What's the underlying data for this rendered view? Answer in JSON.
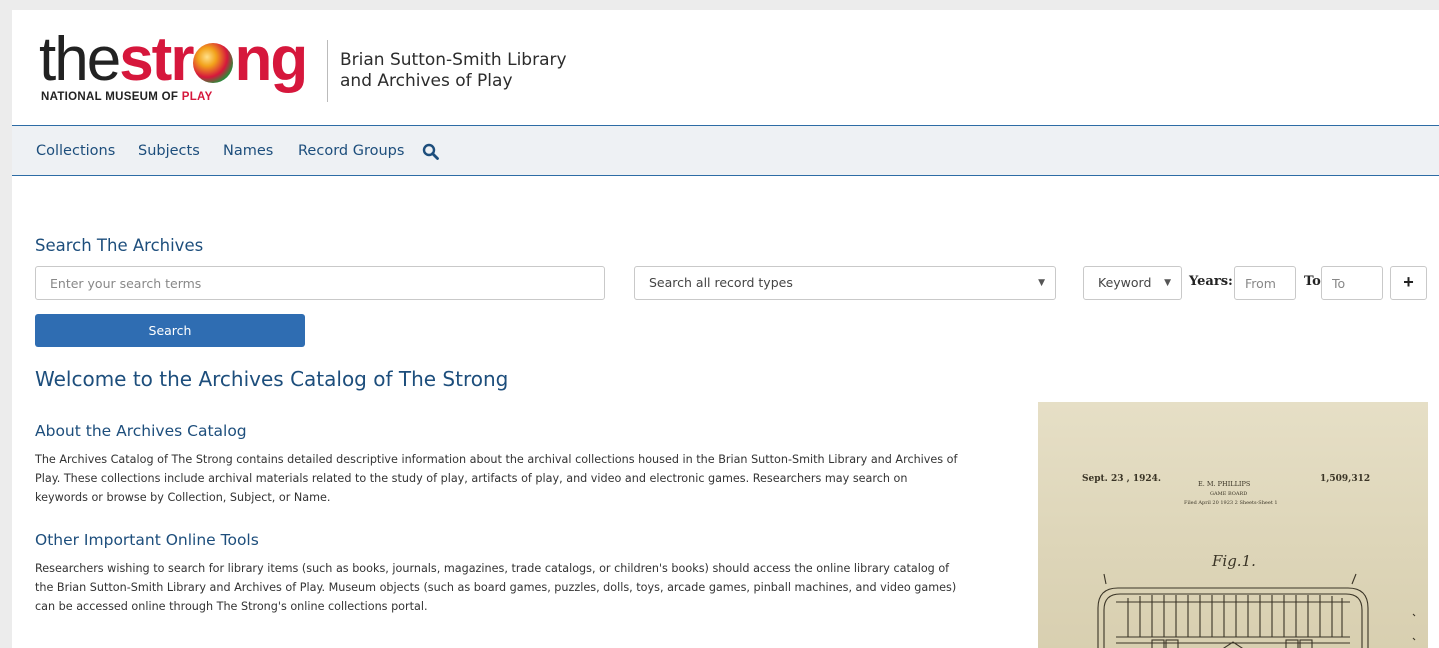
{
  "header": {
    "logo": {
      "word_the": "the",
      "word_str": "str",
      "word_ng": "ng",
      "tag_main": "NATIONAL MUSEUM OF ",
      "tag_play": "PLAY"
    },
    "library_line1": "Brian Sutton-Smith Library",
    "library_line2": "and Archives of Play"
  },
  "nav": {
    "items": [
      {
        "label": "Collections"
      },
      {
        "label": "Subjects"
      },
      {
        "label": "Names"
      },
      {
        "label": "Record Groups"
      }
    ],
    "search_icon": "search-icon"
  },
  "search": {
    "title": "Search The Archives",
    "query_placeholder": "Enter your search terms",
    "record_type_selected": "Search all record types",
    "field_selected": "Keyword",
    "years_label": "Years:",
    "from_placeholder": "From",
    "to_label": "To",
    "to_placeholder": "To",
    "add_label": "+",
    "button_label": "Search"
  },
  "content": {
    "welcome": "Welcome to the Archives Catalog of The Strong",
    "about_title": "About the Archives Catalog",
    "about_p1": "The Archives Catalog of The Strong contains detailed descriptive information about the archival collections housed in the Brian Sutton-Smith Library and Archives of",
    "about_p2": "Play. These collections include archival materials related to the study of play, artifacts of play, and video and electronic games. Researchers may search on",
    "about_p3": "keywords or browse by Collection, Subject, or Name.",
    "tools_title": "Other Important Online Tools",
    "tools_p1": "Researchers wishing to search for library items (such as books, journals, magazines, trade catalogs, or children's books) should access the online library catalog of",
    "tools_p2": "the Brian Sutton-Smith Library and Archives of Play. Museum objects (such as board games, puzzles, dolls, toys, arcade games, pinball machines, and video games)",
    "tools_p3": "can be accessed online through The Strong's online collections portal."
  },
  "patent": {
    "date": "Sept. 23 , 1924.",
    "inventor": "E. M. PHILLIPS",
    "number": "1,509,312",
    "subtitle": "GAME BOARD",
    "filed": "Filed April 20  1923      2 Sheets-Sheet 1",
    "figure": "Fig.1."
  },
  "colors": {
    "brand_red": "#d6173c",
    "link_blue": "#1d4e7c",
    "button_blue": "#2f6db2",
    "nav_bg": "#eef1f4"
  }
}
